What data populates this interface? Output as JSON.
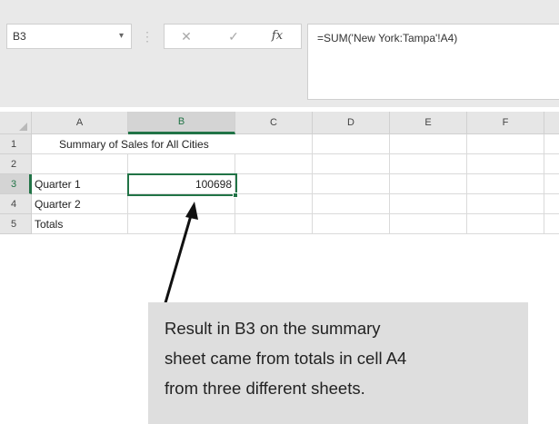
{
  "formula_bar": {
    "name_box": "B3",
    "name_box_caret": "▾",
    "separator": "⋮",
    "cancel_glyph": "✕",
    "enter_glyph": "✓",
    "function_glyph": "fx",
    "formula": "=SUM('New York:Tampa'!A4)"
  },
  "columns": [
    "A",
    "B",
    "C",
    "D",
    "E",
    "F"
  ],
  "rows": [
    "1",
    "2",
    "3",
    "4",
    "5"
  ],
  "cells": {
    "A1": "Summary of Sales for All Cities",
    "A3": "Quarter 1",
    "B3": "100698",
    "A4": "Quarter 2",
    "A5": "Totals"
  },
  "selected_cell": "B3",
  "callout": {
    "line1": "Result in B3 on the summary",
    "line2": "sheet came from totals in cell A4",
    "line3": "from three different sheets."
  }
}
